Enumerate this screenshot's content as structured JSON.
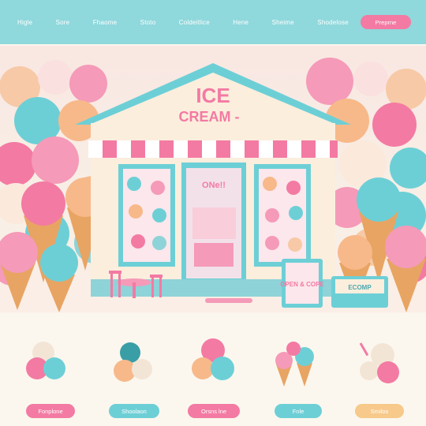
{
  "nav": {
    "items": [
      "Higle",
      "Sore",
      "Fhaome",
      "Stoto",
      "Coldeitlice",
      "Hene",
      "Sheime",
      "Shodelose"
    ],
    "cta_label": "Preprne"
  },
  "sign": {
    "line1": "ICE",
    "line2": "CREAM -"
  },
  "store": {
    "window_sign": "ONe!!",
    "menu_board": "OPEN & COPE",
    "side_board": "ECOMP"
  },
  "cards": [
    {
      "label": "Fonplone",
      "color": "#f37aa3"
    },
    {
      "label": "Shoolaon",
      "color": "#6dcfd6"
    },
    {
      "label": "Orsns lne",
      "color": "#f37aa3"
    },
    {
      "label": "Fnle",
      "color": "#6dcfd6"
    },
    {
      "label": "Smilos",
      "color": "#f7c98a"
    }
  ],
  "colors": {
    "nav_bg": "#8fd8dc",
    "pink": "#f37aa3",
    "teal": "#6dcfd6",
    "cone": "#e8a463",
    "cream": "#fbf6ee"
  }
}
